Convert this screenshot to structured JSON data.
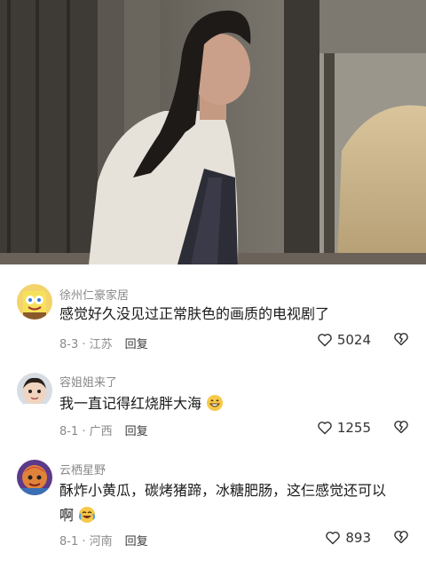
{
  "video": {
    "scene": "drama-still"
  },
  "comments": [
    {
      "username": "徐州仁豪家居",
      "text": "感觉好久没见过正常肤色的画质的电视剧了",
      "emoji": "",
      "date": "8-3",
      "location": "江苏",
      "reply_label": "回复",
      "likes": "5024",
      "avatar_icon": "sponge-cartoon-avatar"
    },
    {
      "username": "容姐姐来了",
      "text": "我一直记得红烧胖大海",
      "emoji": "grinning-face-emoji",
      "date": "8-1",
      "location": "广西",
      "reply_label": "回复",
      "likes": "1255",
      "avatar_icon": "child-photo-avatar"
    },
    {
      "username": "云栖星野",
      "text_line1": "酥炸小黄瓜，碳烤猪蹄，冰糖肥肠，这仨感觉还可以",
      "text_line2": "啊",
      "emoji": "crying-laughing-emoji",
      "date": "8-1",
      "location": "河南",
      "reply_label": "回复",
      "likes": "893",
      "avatar_icon": "illustrated-avatar"
    }
  ],
  "icons": {
    "like": "heart-outline-icon",
    "dislike": "broken-heart-icon"
  },
  "colors": {
    "meta": "#8a8a8a",
    "text": "#1a1a1a"
  }
}
